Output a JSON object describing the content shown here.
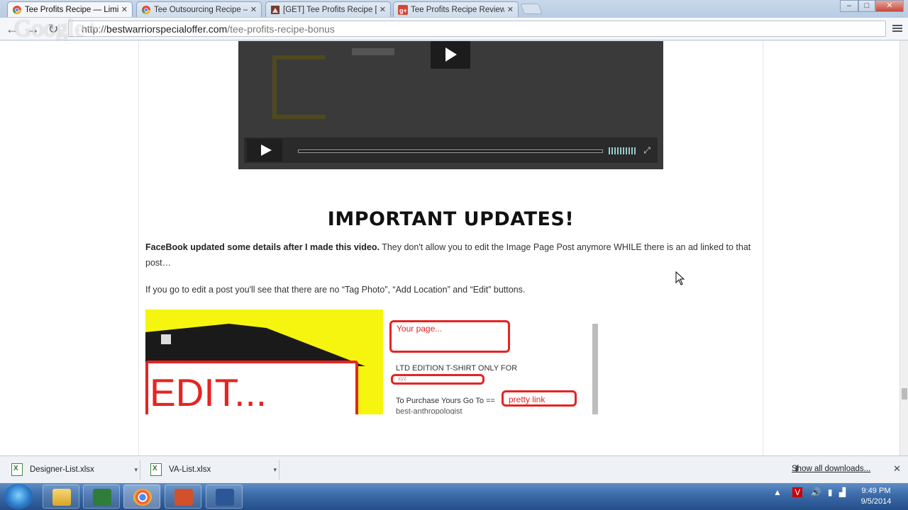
{
  "browser": {
    "tabs": [
      {
        "title": "Tee Profits Recipe — Limi",
        "active": true,
        "icon": "chrome-icon"
      },
      {
        "title": "Tee Outsourcing Recipe —",
        "active": false,
        "icon": "chrome-icon"
      },
      {
        "title": "[GET] Tee Profits Recipe [",
        "active": false,
        "icon": "page-icon"
      },
      {
        "title": "Tee Profits Recipe Review",
        "active": false,
        "icon": "google-plus-icon"
      }
    ],
    "window_controls": {
      "minimize": "–",
      "maximize": "□",
      "close": "✕"
    },
    "url": {
      "scheme": "http://",
      "host": "bestwarriorspecialoffer.com",
      "path": "/tee-profits-recipe-bonus"
    },
    "overlay_watermark": "Google+"
  },
  "page": {
    "heading": "IMPORTANT UPDATES!",
    "paragraph1_bold": "FaceBook updated some details after I made this video.",
    "paragraph1_rest": " They don't allow you to edit the Image Page Post anymore WHILE there is an ad linked to that post…",
    "paragraph2": "If you go to edit a post you'll see that there are no “Tag Photo”, “Add Location” and “Edit” buttons.",
    "screenshot": {
      "edit_text": "EDIT...",
      "your_page": "Your page...",
      "ltd_text": "LTD EDITION T-SHIRT ONLY FOR",
      "xyz": "xyz",
      "purchase_text": "To Purchase Yours Go To ==",
      "pretty_link": "pretty link",
      "anthro": "best-anthropologist"
    }
  },
  "downloads": {
    "items": [
      {
        "name": "Designer-List.xlsx"
      },
      {
        "name": "VA-List.xlsx"
      }
    ],
    "show_all": "Show all downloads..."
  },
  "taskbar": {
    "apps": [
      "windows-explorer",
      "project",
      "chrome",
      "powerpoint",
      "word"
    ],
    "time": "9:49 PM",
    "date": "9/5/2014"
  },
  "colors": {
    "accent_red": "#e52421",
    "flyer_yellow": "#f6f50f"
  }
}
